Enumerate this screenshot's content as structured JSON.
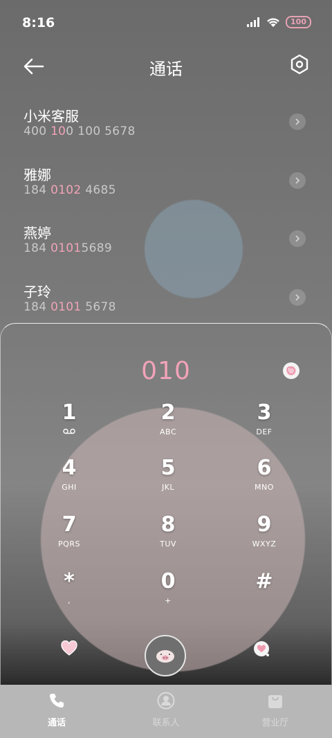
{
  "status_bar": {
    "time": "8:16",
    "battery": "100"
  },
  "header": {
    "title": "通话"
  },
  "contacts": [
    {
      "name": "小米客服",
      "number_parts": [
        "400 ",
        "10",
        "0 100 5678"
      ],
      "number_plain": [
        "400 ",
        "",
        "100 5678"
      ]
    },
    {
      "name": "雅娜",
      "number_parts": [
        "184 ",
        "0102",
        " 4685"
      ]
    },
    {
      "name": "燕婷",
      "number_parts": [
        "184 ",
        "0101",
        "5689"
      ]
    },
    {
      "name": "子玲",
      "number_parts": [
        "184 ",
        "0101",
        " 5678"
      ]
    }
  ],
  "dialer": {
    "entered": "010",
    "keys": [
      {
        "digit": "1",
        "letters": "voicemail"
      },
      {
        "digit": "2",
        "letters": "ABC"
      },
      {
        "digit": "3",
        "letters": "DEF"
      },
      {
        "digit": "4",
        "letters": "GHI"
      },
      {
        "digit": "5",
        "letters": "JKL"
      },
      {
        "digit": "6",
        "letters": "MNO"
      },
      {
        "digit": "7",
        "letters": "PQRS"
      },
      {
        "digit": "8",
        "letters": "TUV"
      },
      {
        "digit": "9",
        "letters": "WXYZ"
      },
      {
        "digit": "*",
        "letters": ","
      },
      {
        "digit": "0",
        "letters": "+"
      },
      {
        "digit": "#",
        "letters": ""
      }
    ]
  },
  "nav": {
    "tabs": [
      {
        "label": "通话"
      },
      {
        "label": "联系人"
      },
      {
        "label": "营业厅"
      }
    ]
  },
  "colors": {
    "accent_pink": "#f1a3b8"
  }
}
